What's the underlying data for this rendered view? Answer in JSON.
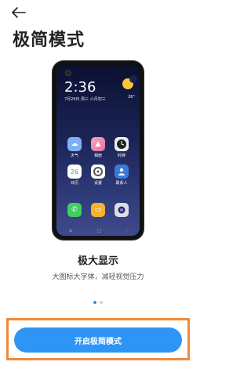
{
  "header": {
    "back_icon": "back-arrow-icon",
    "title": "极简模式"
  },
  "phone_preview": {
    "time": "2:36",
    "date": "7月26日 周三 六月初三",
    "weather_icon": "sun-moon-icon",
    "temperature": "26°",
    "apps": [
      {
        "label": "天气",
        "icon": "weather-icon",
        "color": "#7fb0f5"
      },
      {
        "label": "相册",
        "icon": "gallery-icon",
        "color": "#ef8fb5"
      },
      {
        "label": "时钟",
        "icon": "clock-icon",
        "color": "#eeeeee"
      },
      {
        "label": "日历",
        "icon": "calendar-icon",
        "color": "#4a90e2",
        "text": "26"
      },
      {
        "label": "设置",
        "icon": "settings-icon",
        "color": "#9aa3b3"
      },
      {
        "label": "联系人",
        "icon": "contacts-icon",
        "color": "#3a7bd5"
      }
    ],
    "dock": [
      {
        "icon": "phone-icon",
        "color": "#3ecf5f"
      },
      {
        "icon": "messages-icon",
        "color": "#f5b22e"
      },
      {
        "icon": "camera-icon",
        "color": "#dcdce8"
      }
    ],
    "nav_icons": [
      "menu-icon",
      "home-icon",
      "back-icon"
    ]
  },
  "feature": {
    "title": "极大显示",
    "description": "大图标大字体，减轻视觉压力"
  },
  "pager": {
    "count": 2,
    "active_index": 0
  },
  "cta": {
    "label": "开启极简模式"
  },
  "colors": {
    "accent": "#2f95f5",
    "highlight_frame": "#f08a3c"
  }
}
